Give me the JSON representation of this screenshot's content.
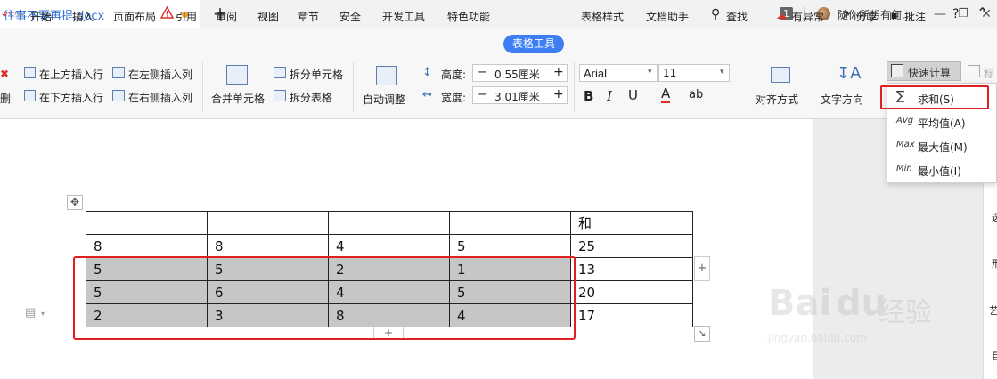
{
  "tabs": {
    "doc_title": "往事不要再提.docx",
    "add": "+"
  },
  "window": {
    "badge": "1",
    "user": "随你所想有何..."
  },
  "menu": {
    "left_cut": "删",
    "items": [
      "开始",
      "插入",
      "页面布局",
      "引用",
      "审阅",
      "视图",
      "章节",
      "安全",
      "开发工具",
      "特色功能"
    ],
    "active": "表格工具",
    "items_after": [
      "表格样式",
      "文档助手"
    ],
    "search": "查找",
    "right": {
      "status": "有异常",
      "share": "分享",
      "comment": "批注",
      "help": "?"
    }
  },
  "ribbon": {
    "insert_above": "在上方插入行",
    "insert_below": "在下方插入行",
    "insert_left": "在左侧插入列",
    "insert_right": "在右侧插入列",
    "merge": "合并单元格",
    "split_cell": "拆分单元格",
    "split_table": "拆分表格",
    "auto_fit": "自动调整",
    "height_label": "高度:",
    "height_value": "0.55厘米",
    "width_label": "宽度:",
    "width_value": "3.01厘米",
    "font": "Arial",
    "size": "11",
    "align": "对齐方式",
    "text_dir": "文字方向",
    "quick_calc": "快速计算",
    "cut_right": "标"
  },
  "dropdown": [
    {
      "icon": "∑",
      "label": "求和(S)"
    },
    {
      "icon": "Avg",
      "label": "平均值(A)"
    },
    {
      "icon": "Max",
      "label": "最大值(M)"
    },
    {
      "icon": "Min",
      "label": "最小值(I)"
    }
  ],
  "table": {
    "rows": [
      [
        "",
        "",
        "",
        "",
        "和"
      ],
      [
        "8",
        "8",
        "4",
        "5",
        "25"
      ],
      [
        "5",
        "5",
        "2",
        "1",
        "13"
      ],
      [
        "5",
        "6",
        "4",
        "5",
        "20"
      ],
      [
        "2",
        "3",
        "8",
        "4",
        "17"
      ]
    ],
    "selected_rows": [
      2,
      3,
      4
    ],
    "selected_cols": [
      0,
      1,
      2,
      3
    ]
  },
  "watermark": {
    "brand": "Bai",
    "brand2": "du",
    "cn": "经验",
    "url": "jingyan.baidu.com"
  },
  "side_chars": [
    "选",
    "形",
    "艺",
    "目"
  ],
  "colors": {
    "accent": "#3d7ef5",
    "highlight_red": "#e02020",
    "selection": "#c6c6c6"
  }
}
